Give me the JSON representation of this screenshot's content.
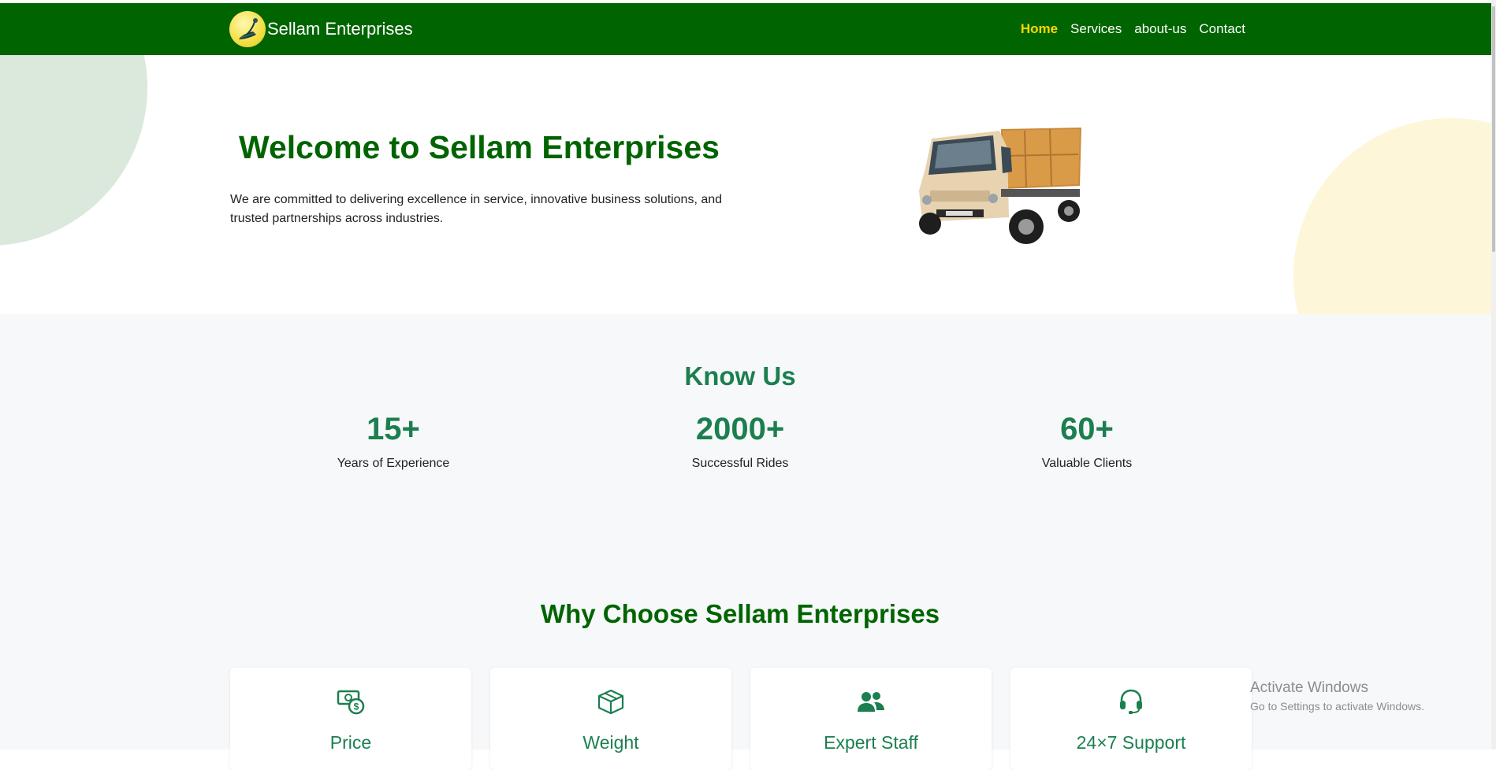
{
  "brand": {
    "name": "Sellam Enterprises",
    "logo": "peacock-logo"
  },
  "nav": {
    "items": [
      {
        "label": "Home",
        "active": true
      },
      {
        "label": "Services",
        "active": false
      },
      {
        "label": "about-us",
        "active": false
      },
      {
        "label": "Contact",
        "active": false
      }
    ]
  },
  "hero": {
    "title": "Welcome to Sellam Enterprises",
    "text": "We are committed to delivering excellence in service, innovative business solutions, and trusted partnerships across industries.",
    "image": "delivery-truck"
  },
  "know": {
    "title": "Know Us",
    "stats": [
      {
        "value": "15+",
        "label": "Years of Experience"
      },
      {
        "value": "2000+",
        "label": "Successful Rides"
      },
      {
        "value": "60+",
        "label": "Valuable Clients"
      }
    ]
  },
  "why": {
    "title": "Why Choose Sellam Enterprises",
    "cards": [
      {
        "title": "Price",
        "icon": "money-icon"
      },
      {
        "title": "Weight",
        "icon": "box-icon"
      },
      {
        "title": "Expert Staff",
        "icon": "users-icon"
      },
      {
        "title": "24×7 Support",
        "icon": "headset-icon"
      }
    ]
  },
  "watermark": {
    "title": "Activate Windows",
    "subtitle": "Go to Settings to activate Windows."
  },
  "colors": {
    "primary": "#006400",
    "accent": "#1b7f4f",
    "active_nav": "#ffd700",
    "section_bg": "#f7f8fa"
  }
}
